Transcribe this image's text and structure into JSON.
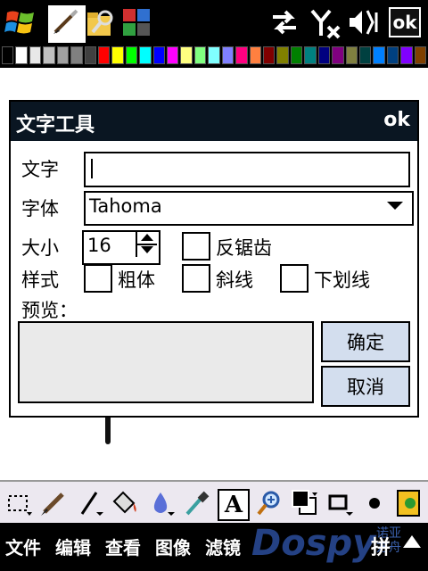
{
  "statusbar": {
    "ok_label": "ok"
  },
  "palette": [
    "#000000",
    "#ffffff",
    "#e8e8e8",
    "#c0c0c0",
    "#a0a0a0",
    "#808080",
    "#404040",
    "#ff0000",
    "#ffff00",
    "#00ff00",
    "#00ffff",
    "#0000ff",
    "#ff00ff",
    "#ffff80",
    "#80ff80",
    "#80ffff",
    "#8080ff",
    "#ff0080",
    "#ff8040",
    "#800000",
    "#808000",
    "#008000",
    "#008080",
    "#000080",
    "#800080",
    "#808040",
    "#004040",
    "#0080ff",
    "#004080",
    "#8000ff",
    "#804000"
  ],
  "dialog": {
    "title": "文字工具",
    "ok_label": "ok",
    "text_label": "文字",
    "text_value": "",
    "font_label": "字体",
    "font_value": "Tahoma",
    "size_label": "大小",
    "size_value": "16",
    "antialias_label": "反锯齿",
    "style_label": "样式",
    "bold_label": "粗体",
    "italic_label": "斜线",
    "underline_label": "下划线",
    "preview_label": "预览：",
    "confirm_label": "确定",
    "cancel_label": "取消"
  },
  "toolbar": {
    "text_tool_glyph": "A"
  },
  "menubar": {
    "items": [
      "文件",
      "编辑",
      "查看",
      "图像",
      "滤镜"
    ],
    "ime_label": "拼",
    "watermark": "Dospy",
    "watermark_sub": [
      "诺亚",
      "方舟"
    ]
  }
}
